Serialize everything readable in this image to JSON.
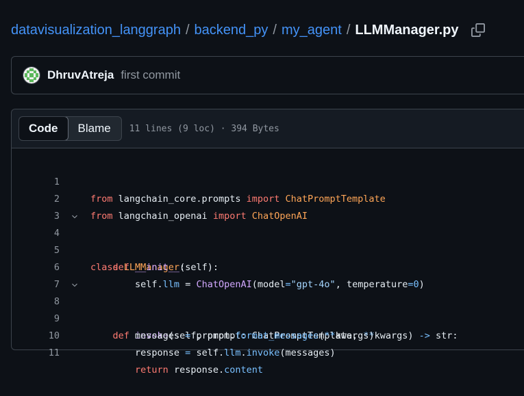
{
  "breadcrumb": {
    "repo": "datavisualization_langgraph",
    "dir1": "backend_py",
    "dir2": "my_agent",
    "separator": "/",
    "file": "LLMManager.py",
    "copy_icon": "copy-icon"
  },
  "commit": {
    "author": "DhruvAtreja",
    "message": "first commit"
  },
  "file_header": {
    "code_tab": "Code",
    "blame_tab": "Blame",
    "meta": "11 lines (9 loc) · 394 Bytes"
  },
  "code": {
    "line_numbers": [
      "1",
      "2",
      "3",
      "4",
      "5",
      "6",
      "7",
      "8",
      "9",
      "10",
      "11"
    ],
    "l1": {
      "t0": "from",
      "t1": " langchain_core.prompts ",
      "t2": "import",
      "t3": " ChatPromptTemplate"
    },
    "l2": {
      "t0": "from",
      "t1": " langchain_openai ",
      "t2": "import",
      "t3": " ChatOpenAI"
    },
    "l4": {
      "t0": "class",
      "t1": " LLMManager",
      "t2": ":"
    },
    "l5": {
      "t0": "    ",
      "t1": "def",
      "t2": " __init__",
      "t3": "(self):"
    },
    "l6": {
      "t0": "        self.",
      "t1": "llm",
      "t2": " = ",
      "t3": "ChatOpenAI",
      "t4": "(model",
      "t5": "=",
      "t6": "\"gpt-4o\"",
      "t7": ", temperature",
      "t8": "=",
      "t9": "0",
      "t10": ")"
    },
    "l8": {
      "t0": "    ",
      "t1": "def",
      "t2": " invoke",
      "t3": "(self, prompt: ChatPromptTemplate, ",
      "t4": "**",
      "t5": "kwargs) ",
      "t6": "->",
      "t7": " str:"
    },
    "l9": {
      "t0": "        messages ",
      "t1": "=",
      "t2": " prompt.",
      "t3": "format_messages",
      "t4": "(",
      "t5": "**",
      "t6": "kwargs)"
    },
    "l10": {
      "t0": "        response ",
      "t1": "=",
      "t2": " self.",
      "t3": "llm",
      "t4": ".",
      "t5": "invoke",
      "t6": "(messages)"
    },
    "l11": {
      "t0": "        ",
      "t1": "return",
      "t2": " response.",
      "t3": "content"
    }
  },
  "colors": {
    "background": "#0d1117",
    "link": "#4493f8",
    "keyword": "#ff7b72",
    "class": "#ffa657",
    "function": "#d2a8ff",
    "property": "#79c0ff",
    "string": "#a5d6ff"
  }
}
